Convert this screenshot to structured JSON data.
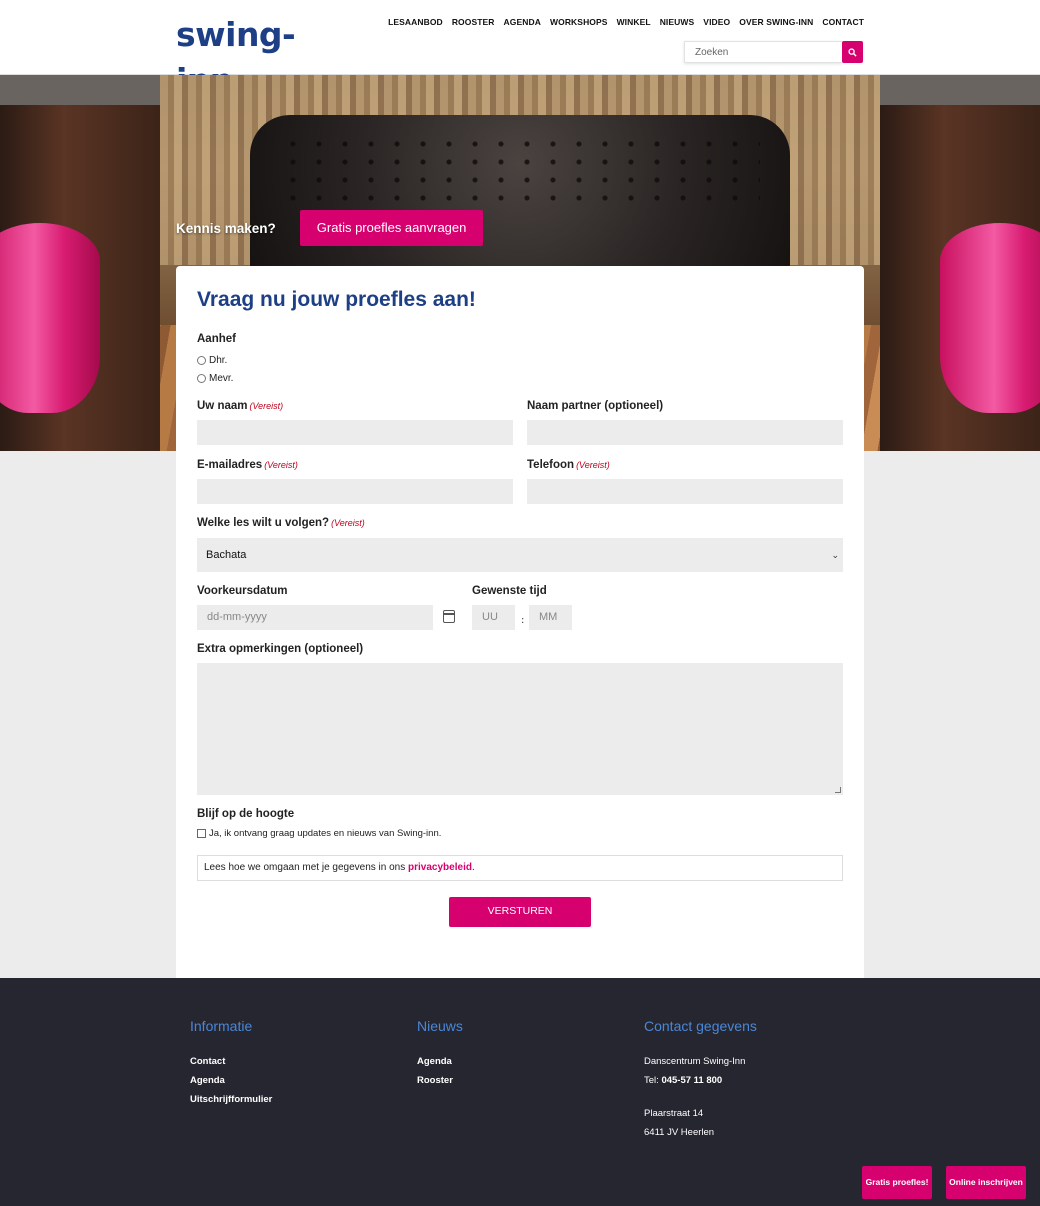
{
  "header": {
    "logo_text": "swing-inn",
    "nav": [
      "LESAANBOD",
      "ROOSTER",
      "AGENDA",
      "WORKSHOPS",
      "WINKEL",
      "NIEUWS",
      "VIDEO",
      "OVER SWING-INN",
      "CONTACT"
    ],
    "search_placeholder": "Zoeken"
  },
  "hero": {
    "cta_label": "Kennis maken?",
    "cta_button": "Gratis proefles aanvragen"
  },
  "form": {
    "title": "Vraag nu jouw proefles aan!",
    "salutation_label": "Aanhef",
    "salutation_options": [
      "Dhr.",
      "Mevr."
    ],
    "required_text": "(Vereist)",
    "name_label": "Uw naam",
    "partner_label": "Naam partner (optioneel)",
    "email_label": "E-mailadres",
    "phone_label": "Telefoon",
    "lesson_label": "Welke les wilt u volgen?",
    "lesson_value": "Bachata",
    "date_label": "Voorkeursdatum",
    "date_placeholder": "dd-mm-yyyy",
    "time_label": "Gewenste tijd",
    "hour_placeholder": "UU",
    "time_separator": ":",
    "minute_placeholder": "MM",
    "remarks_label": "Extra opmerkingen (optioneel)",
    "updates_label": "Blijf op de hoogte",
    "updates_checkbox": "Ja, ik ontvang graag updates en nieuws van Swing-inn.",
    "privacy_text": "Lees hoe we omgaan met je gegevens in ons ",
    "privacy_link": "privacybeleid",
    "privacy_end": ".",
    "submit": "VERSTUREN"
  },
  "footer": {
    "col1": {
      "title": "Informatie",
      "links": [
        "Contact",
        "Agenda",
        "Uitschrijfformulier"
      ]
    },
    "col2": {
      "title": "Nieuws",
      "links": [
        "Agenda",
        "Rooster"
      ]
    },
    "col3": {
      "title": "Contact gegevens",
      "name": "Danscentrum Swing-Inn",
      "tel_label": "Tel: ",
      "tel": "045-57 11 800",
      "street": "Plaarstraat 14",
      "city": "6411 JV Heerlen"
    }
  },
  "floating": {
    "trial": "Gratis proefles!",
    "signup": "Online inschrijven"
  },
  "colors": {
    "brand_pink": "#d6006f",
    "brand_blue": "#1d3f86",
    "footer_bg": "#262630",
    "footer_heading": "#4a87d6"
  }
}
